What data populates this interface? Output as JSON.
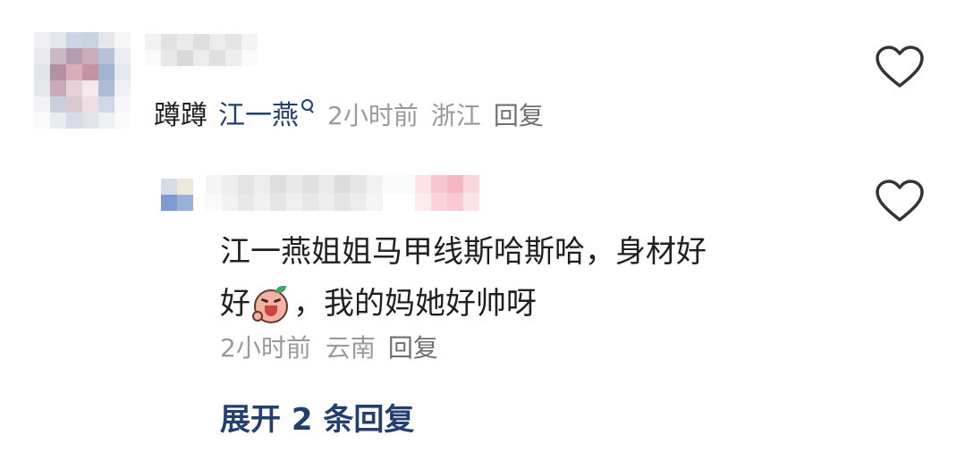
{
  "comment": {
    "body": "蹲蹲",
    "mention": "江一燕",
    "time": "2小时前",
    "location": "浙江",
    "reply_label": "回复"
  },
  "reply": {
    "text_line1": "江一燕姐姐马甲线斯哈斯哈，身材好",
    "text_line2_a": "好",
    "text_line2_b": "，我的妈她好帅呀",
    "time": "2小时前",
    "location": "云南",
    "reply_label": "回复"
  },
  "expand": {
    "label": "展开 2 条回复"
  },
  "icons": {
    "like": "heart-outline-icon",
    "mention_search": "search-icon",
    "emoji": "crying-laughing-face-icon"
  },
  "colors": {
    "accent": "#233f6e",
    "meta": "#9a9a9a",
    "text": "#1f1f1f",
    "like_stroke": "#333333"
  }
}
